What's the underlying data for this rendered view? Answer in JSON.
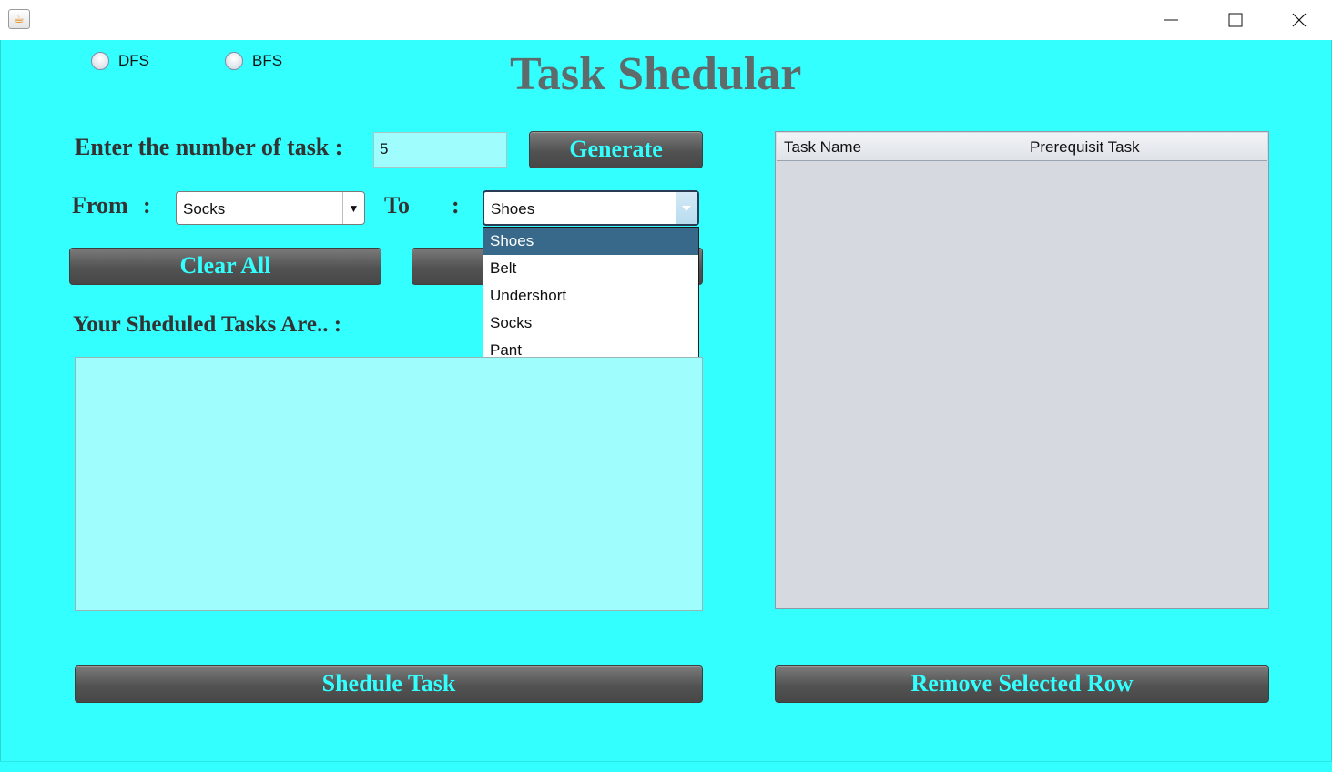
{
  "window": {
    "app_icon": "java-coffee-cup-icon",
    "controls": [
      "minimize-icon",
      "maximize-icon",
      "close-icon"
    ]
  },
  "algorithm_options": [
    {
      "label": "DFS",
      "selected": false
    },
    {
      "label": "BFS",
      "selected": false
    }
  ],
  "title": "Task Shedular",
  "task_count": {
    "label": "Enter the number of task :",
    "value": "5",
    "button": "Generate"
  },
  "from": {
    "label": "From",
    "colon": ":",
    "selected": "Socks"
  },
  "to": {
    "label": "To",
    "colon": ":",
    "selected": "Shoes",
    "options": [
      "Shoes",
      "Belt",
      "Undershort",
      "Socks",
      "Pant"
    ],
    "highlighted_index": 0
  },
  "clear_button": "Clear All",
  "scheduled_label": "Your Sheduled Tasks Are.. :",
  "scheduled_output": "",
  "table": {
    "columns": [
      "Task Name",
      "Prerequisit Task"
    ],
    "rows": []
  },
  "schedule_button": "Shedule Task",
  "remove_button": "Remove Selected Row",
  "colors": {
    "background": "#33ffff",
    "button_text": "#33ffff",
    "title": "#5f6a6a",
    "dropdown_highlight": "#39698a"
  }
}
